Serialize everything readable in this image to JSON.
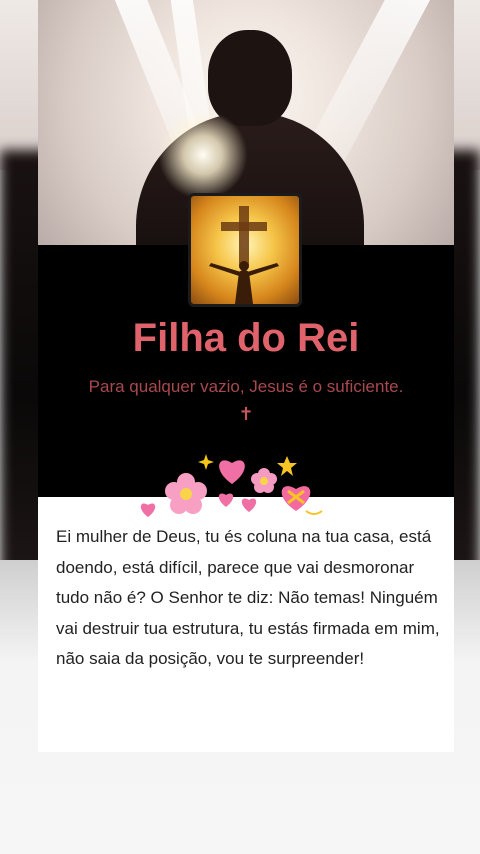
{
  "profile": {
    "title": "Filha do Rei",
    "subtitle": "Para qualquer vazio, Jesus é o suficiente.",
    "cross": "✝"
  },
  "post": {
    "text": "Ei mulher de Deus, tu és coluna na tua casa, está doendo, está difícil, parece que vai desmoronar tudo não é? O Senhor te diz: Não temas! Ninguém vai destruir tua estrutura, tu estás firmada em mim, não saia da posição, vou te surpreender!"
  },
  "colors": {
    "title": "#e0636c",
    "subtitle": "#a8494f",
    "card_background": "#000000",
    "text_box": "#ffffff"
  },
  "icons": [
    "sparkles-icon",
    "heart-icon",
    "star-icon",
    "flower-icon",
    "heart-with-ribbon-icon"
  ]
}
